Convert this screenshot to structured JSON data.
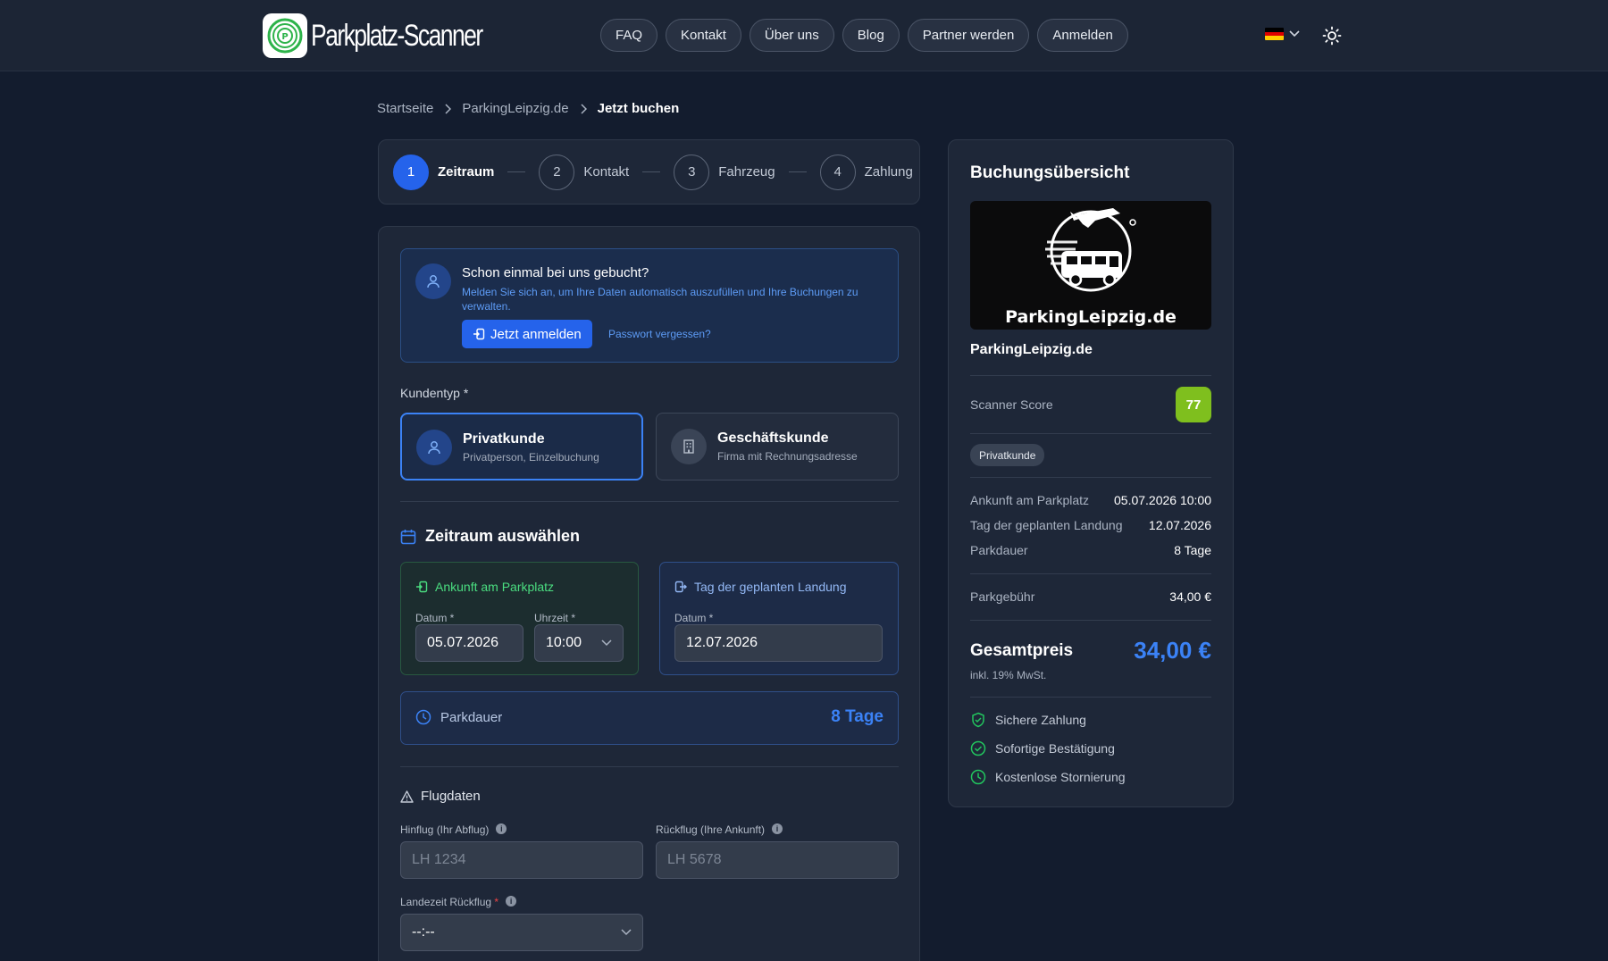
{
  "header": {
    "logo_text": "Parkplatz-Scanner",
    "nav": [
      "FAQ",
      "Kontakt",
      "Über uns",
      "Blog",
      "Partner werden",
      "Anmelden"
    ]
  },
  "breadcrumb": [
    "Startseite",
    "ParkingLeipzig.de",
    "Jetzt buchen"
  ],
  "stepper": [
    {
      "num": "1",
      "label": "Zeitraum"
    },
    {
      "num": "2",
      "label": "Kontakt"
    },
    {
      "num": "3",
      "label": "Fahrzeug"
    },
    {
      "num": "4",
      "label": "Zahlung"
    }
  ],
  "login": {
    "title": "Schon einmal bei uns gebucht?",
    "desc": "Melden Sie sich an, um Ihre Daten automatisch auszufüllen und Ihre Buchungen zu verwalten.",
    "button": "Jetzt anmelden",
    "forgot": "Passwort vergessen?"
  },
  "customer_type": {
    "label": "Kundentyp *",
    "private": {
      "title": "Privatkunde",
      "sub": "Privatperson, Einzelbuchung"
    },
    "business": {
      "title": "Geschäftskunde",
      "sub": "Firma mit Rechnungsadresse"
    }
  },
  "period": {
    "title": "Zeitraum auswählen",
    "arrival": {
      "title": "Ankunft am Parkplatz",
      "date_label": "Datum *",
      "date": "05.07.2026",
      "time_label": "Uhrzeit *",
      "time": "10:00"
    },
    "landing": {
      "title": "Tag der geplanten Landung",
      "date_label": "Datum *",
      "date": "12.07.2026"
    },
    "duration_label": "Parkdauer",
    "duration_value": "8 Tage"
  },
  "flight": {
    "title": "Flugdaten",
    "outbound_label": "Hinflug (Ihr Abflug)",
    "outbound_placeholder": "LH 1234",
    "return_label": "Rückflug (Ihre Ankunft)",
    "return_placeholder": "LH 5678",
    "landing_time_label": "Landezeit Rückflug",
    "landing_time_required": "*",
    "landing_time_value": "--:--"
  },
  "summary": {
    "title": "Buchungsübersicht",
    "image_caption": "ParkingLeipzig.de",
    "name": "ParkingLeipzig.de",
    "score_label": "Scanner Score",
    "score": "77",
    "customer_pill": "Privatkunde",
    "arrival_label": "Ankunft am Parkplatz",
    "arrival_value": "05.07.2026 10:00",
    "landing_label": "Tag der geplanten Landung",
    "landing_value": "12.07.2026",
    "duration_label": "Parkdauer",
    "duration_value": "8 Tage",
    "fee_label": "Parkgebühr",
    "fee_value": "34,00 €",
    "total_label": "Gesamtpreis",
    "total_value": "34,00 €",
    "vat": "inkl. 19% MwSt.",
    "features": [
      "Sichere Zahlung",
      "Sofortige Bestätigung",
      "Kostenlose Stornierung"
    ]
  },
  "colors": {
    "accent": "#2563eb",
    "score": "#7fbf1e",
    "success": "#22c55e"
  }
}
